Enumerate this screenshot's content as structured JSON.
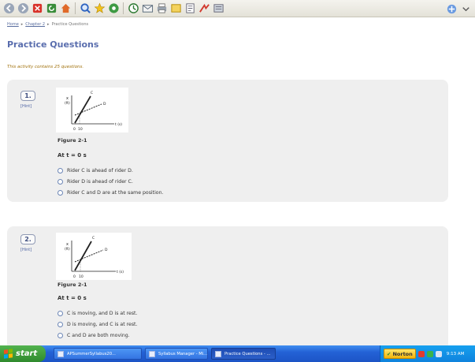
{
  "breadcrumb": {
    "home": "Home",
    "sep1": "▸",
    "chapter": "Chapter 2",
    "sep2": "▸",
    "current": "Practice Questions"
  },
  "page": {
    "title": "Practice Questions",
    "intro": "This activity contains 25 questions."
  },
  "questions": [
    {
      "number": "1.",
      "hint": "[Hint]",
      "figure": {
        "caption": "Figure 2-1",
        "ylabel_top": "x",
        "ylabel_bottom": "(ft)",
        "xlabel": "t (s)",
        "tick0": "0",
        "tick1": "10",
        "line_c": "C",
        "line_d": "D"
      },
      "prompt": "At t = 0 s",
      "options": [
        "Rider C is ahead of rider D.",
        "Rider D is ahead of rider C.",
        "Rider C and D are at the same position."
      ]
    },
    {
      "number": "2.",
      "hint": "[Hint]",
      "figure": {
        "caption": "Figure 2-1",
        "ylabel_top": "x",
        "ylabel_bottom": "(ft)",
        "xlabel": "t (s)",
        "tick0": "0",
        "tick1": "10",
        "line_c": "C",
        "line_d": "D"
      },
      "prompt": "At t = 0 s",
      "options": [
        "C is moving, and D is at rest.",
        "D is moving, and C is at rest.",
        "C and D are both moving."
      ]
    }
  ],
  "taskbar": {
    "start_label": "start",
    "tasks": [
      "APSummerSyllabus20...",
      "Syllabus Manager - Mi...",
      "Practice Questions - ..."
    ],
    "norton_label": "Norton",
    "clock": "9:13 AM"
  },
  "icons": {
    "toolbar": [
      "back-icon",
      "forward-icon",
      "stop-icon",
      "refresh-icon",
      "home-icon",
      "search-icon",
      "favorites-icon",
      "media-icon",
      "history-icon",
      "mail-icon",
      "print-icon",
      "edit-icon",
      "discuss-icon",
      "research-icon",
      "messenger-icon",
      "tools-icon"
    ]
  },
  "colors": {
    "title": "#5a6eae",
    "intro": "#a1720d",
    "card": "#efefef",
    "taskbar": "#2462d6",
    "start": "#2f8a2d"
  }
}
